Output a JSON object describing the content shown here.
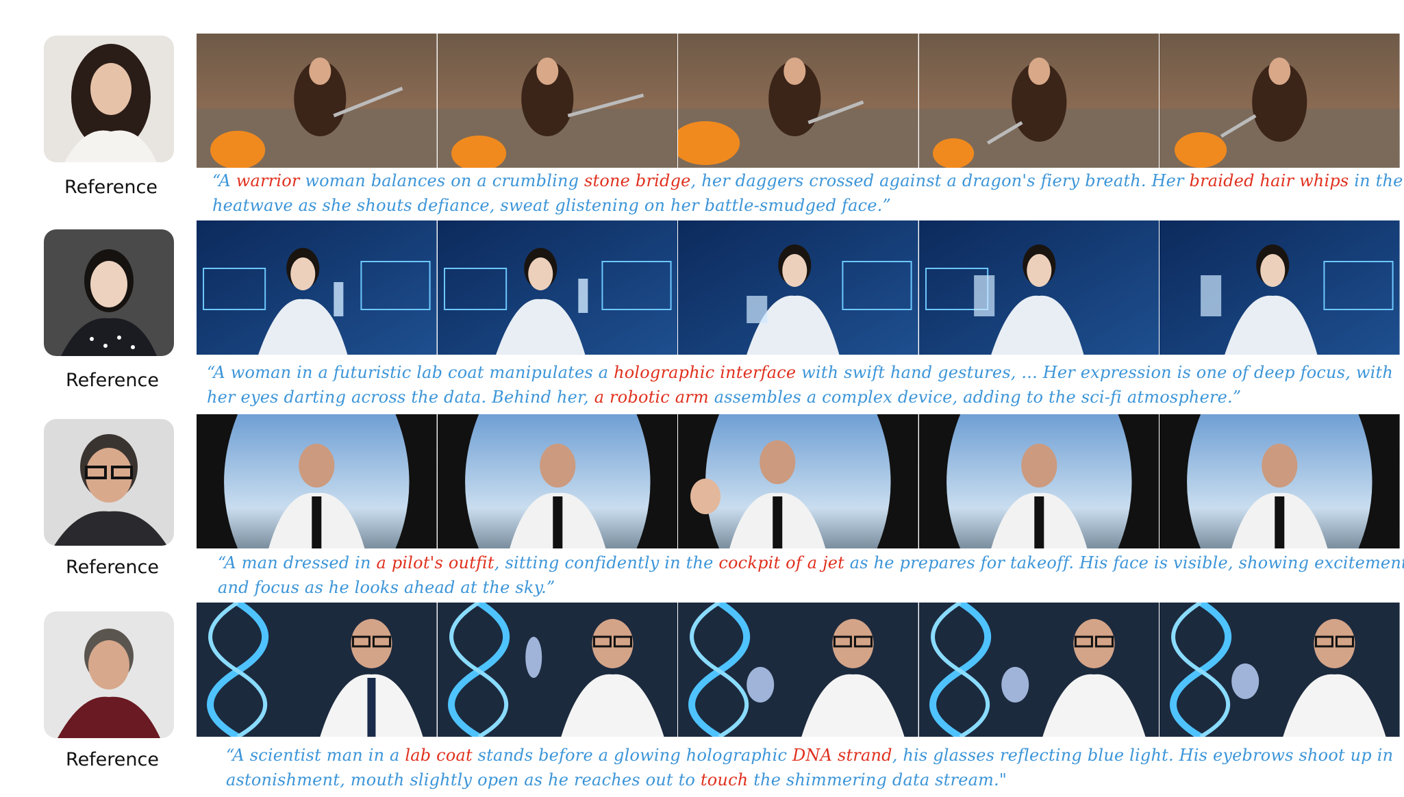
{
  "rows": [
    {
      "reference_label": "Reference",
      "caption": {
        "open": "“A ",
        "k1": "warrior",
        "t1": " woman balances on a crumbling ",
        "k2": "stone bridge",
        "t2": ", her daggers crossed against a dragon's fiery breath. Her ",
        "k3": "braided hair whips",
        "t3": " in the heatwave as she shouts defiance, sweat glistening on her battle-smudged face.”"
      }
    },
    {
      "reference_label": "Reference",
      "caption": {
        "open": "“A woman in a futuristic lab coat manipulates a ",
        "k1": "holographic interface",
        "t1": " with swift hand gestures, ... Her expression is one of deep focus, with her eyes darting across the data. Behind her, ",
        "k2": "a robotic arm",
        "t2": " assembles a complex device, adding to the sci-fi atmosphere.”"
      }
    },
    {
      "reference_label": "Reference",
      "caption": {
        "open": "“A man dressed in ",
        "k1": "a pilot's outfit",
        "t1": ", sitting confidently in the ",
        "k2": "cockpit of a jet",
        "t2": " as he prepares for takeoff. His face is visible, showing excitement and focus as he looks ahead at the sky.”"
      }
    },
    {
      "reference_label": "Reference",
      "caption": {
        "open": "“A scientist man in a ",
        "k1": "lab coat",
        "t1": " stands before a glowing holographic ",
        "k2": "DNA strand",
        "t2": ", his glasses reflecting blue light. His eyebrows shoot up in astonishment, mouth slightly open as he reaches out to ",
        "k3": "touch",
        "t3": " the shimmering data stream.\""
      }
    }
  ],
  "colors": {
    "caption_text": "#3c95d8",
    "caption_highlight": "#e0301e",
    "label_text": "#111111"
  }
}
